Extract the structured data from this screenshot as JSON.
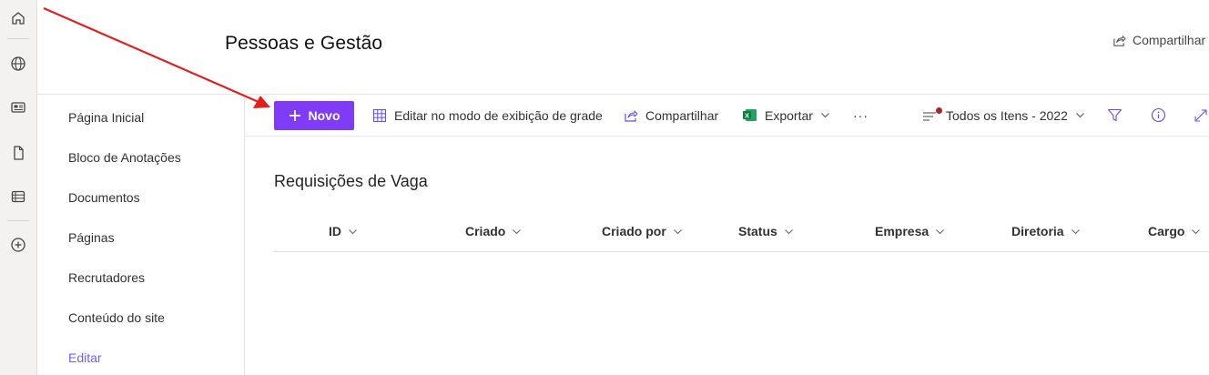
{
  "site": {
    "title": "Pessoas e Gestão",
    "share_label": "Compartilhar"
  },
  "rail": {
    "icons": [
      "home-icon",
      "globe-icon",
      "news-icon",
      "document-icon",
      "list-icon",
      "add-circle-icon"
    ]
  },
  "nav": {
    "items": [
      {
        "label": "Página Inicial"
      },
      {
        "label": "Bloco de Anotações"
      },
      {
        "label": "Documentos"
      },
      {
        "label": "Páginas"
      },
      {
        "label": "Recrutadores"
      },
      {
        "label": "Conteúdo do site"
      }
    ],
    "edit_label": "Editar"
  },
  "command_bar": {
    "new_label": "Novo",
    "grid_edit_label": "Editar no modo de exibição de grade",
    "share_label": "Compartilhar",
    "export_label": "Exportar",
    "more_label": "···",
    "view_label": "Todos os Itens - 2022"
  },
  "list": {
    "title": "Requisições de Vaga",
    "columns": [
      "ID",
      "Criado",
      "Criado por",
      "Status",
      "Empresa",
      "Diretoria",
      "Cargo"
    ]
  },
  "colors": {
    "accent": "#7f3bf5",
    "excel": "#107c41",
    "annotation_arrow": "#e02020",
    "view_dot": "#a4262c"
  }
}
